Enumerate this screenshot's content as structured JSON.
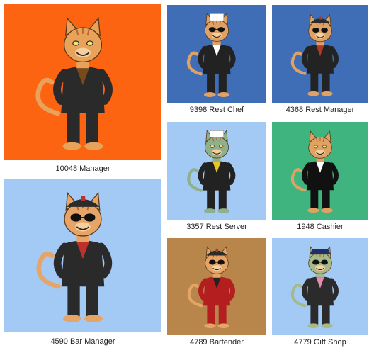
{
  "cards": [
    {
      "caption": "10048 Manager",
      "bg": "#fd6412",
      "fur": "#e8a25a",
      "outfit": "#2a2a2a",
      "accent": "#7a4a18",
      "hat": "none",
      "glasses": false
    },
    {
      "caption": "9398 Rest Chef",
      "bg": "#3f6eb7",
      "fur": "#e0a264",
      "outfit": "#222222",
      "accent": "#ffffff",
      "hat": "chef",
      "glasses": true
    },
    {
      "caption": "4368 Rest Manager",
      "bg": "#3f6eb7",
      "fur": "#e0a264",
      "outfit": "#232323",
      "accent": "#b0372b",
      "hat": "cap",
      "glasses": true
    },
    {
      "caption": "3357 Rest Server",
      "bg": "#a3c9f5",
      "fur": "#8fb08a",
      "outfit": "#222222",
      "accent": "#e8c52a",
      "hat": "chef",
      "glasses": false
    },
    {
      "caption": "1948 Cashier",
      "bg": "#3fb47e",
      "fur": "#e0a264",
      "outfit": "#111111",
      "accent": "#ffffff",
      "hat": "none",
      "glasses": false
    },
    {
      "caption": "4590 Bar Manager",
      "bg": "#a3c9f5",
      "fur": "#e6a467",
      "outfit": "#2a2a2a",
      "accent": "#c0302a",
      "hat": "cap",
      "glasses": true
    },
    {
      "caption": "4789 Bartender",
      "bg": "#b8864a",
      "fur": "#e6a467",
      "outfit": "#b41e1e",
      "accent": "#222222",
      "hat": "cap",
      "glasses": true
    },
    {
      "caption": "4779 Gift Shop",
      "bg": "#a3c9f5",
      "fur": "#a6b98a",
      "outfit": "#2b2b2b",
      "accent": "#e58bb0",
      "hat": "police",
      "glasses": true
    }
  ]
}
